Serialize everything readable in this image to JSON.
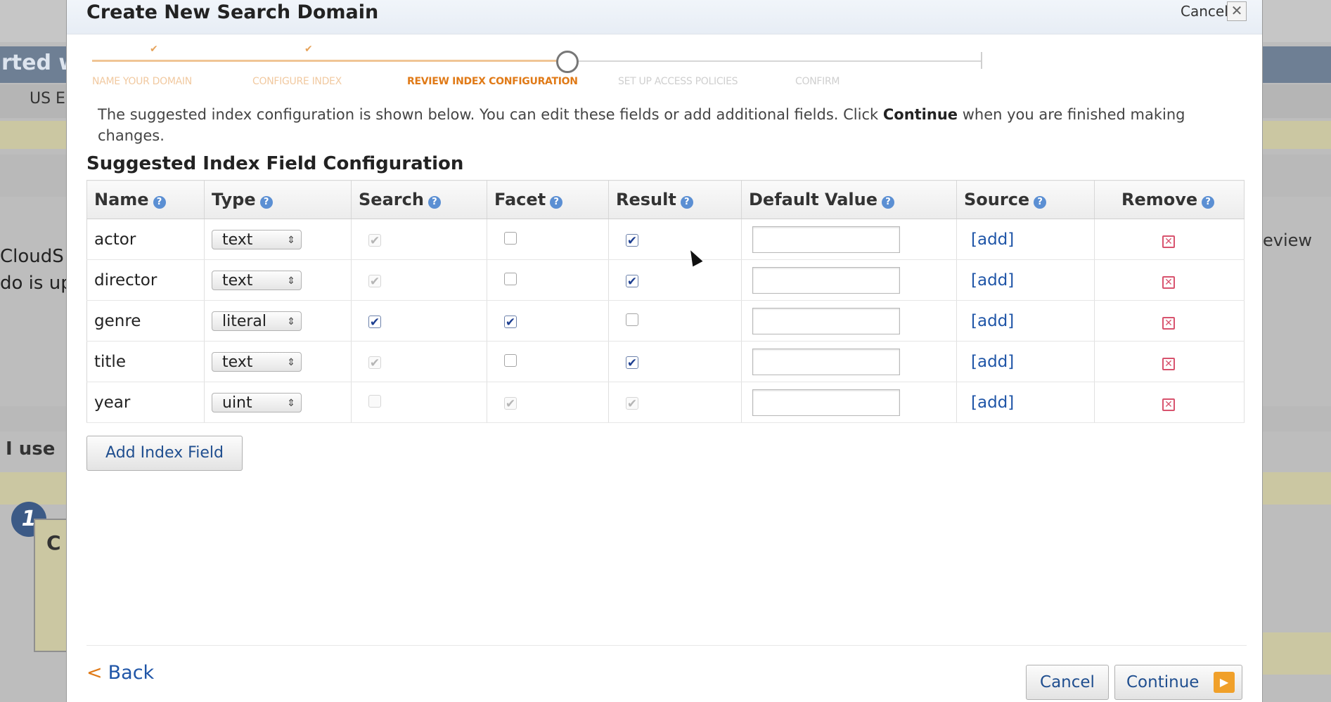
{
  "background": {
    "nav_text": "rted w",
    "region": "US E",
    "cloud_lines": [
      "CloudS",
      "do is up"
    ],
    "review_text": "eview",
    "iuse_text": "I use",
    "step_number": "1",
    "card_letter": "C"
  },
  "dialog": {
    "title": "Create New Search Domain",
    "cancel_top": "Cancel",
    "close_glyph": "✕"
  },
  "steps": [
    {
      "label": "NAME YOUR DOMAIN",
      "state": "done"
    },
    {
      "label": "CONFIGURE INDEX",
      "state": "done"
    },
    {
      "label": "REVIEW INDEX CONFIGURATION",
      "state": "current"
    },
    {
      "label": "SET UP ACCESS POLICIES",
      "state": "todo"
    },
    {
      "label": "CONFIRM",
      "state": "todo"
    }
  ],
  "instructions": {
    "before": "The suggested index configuration is shown below. You can edit these fields or add additional fields. Click ",
    "bold": "Continue",
    "after": " when you are finished making changes."
  },
  "section_title": "Suggested Index Field Configuration",
  "table": {
    "headers": [
      "Name",
      "Type",
      "Search",
      "Facet",
      "Result",
      "Default Value",
      "Source",
      "Remove"
    ],
    "add_link": "[add]",
    "rows": [
      {
        "name": "actor",
        "type": "text",
        "search": "disabled-checked",
        "facet": "unchecked",
        "result": "checked",
        "default": ""
      },
      {
        "name": "director",
        "type": "text",
        "search": "disabled-checked",
        "facet": "unchecked",
        "result": "checked",
        "default": ""
      },
      {
        "name": "genre",
        "type": "literal",
        "search": "checked",
        "facet": "checked",
        "result": "unchecked",
        "default": ""
      },
      {
        "name": "title",
        "type": "text",
        "search": "disabled-checked",
        "facet": "unchecked",
        "result": "checked",
        "default": ""
      },
      {
        "name": "year",
        "type": "uint",
        "search": "disabled-unchecked",
        "facet": "disabled-checked",
        "result": "disabled-checked",
        "default": ""
      }
    ]
  },
  "buttons": {
    "add_field": "Add Index Field",
    "back": "Back",
    "cancel": "Cancel",
    "continue": "Continue"
  },
  "colors": {
    "accent_orange": "#e07a17",
    "link_blue": "#1f55a7",
    "remove_red": "#d8536e"
  }
}
